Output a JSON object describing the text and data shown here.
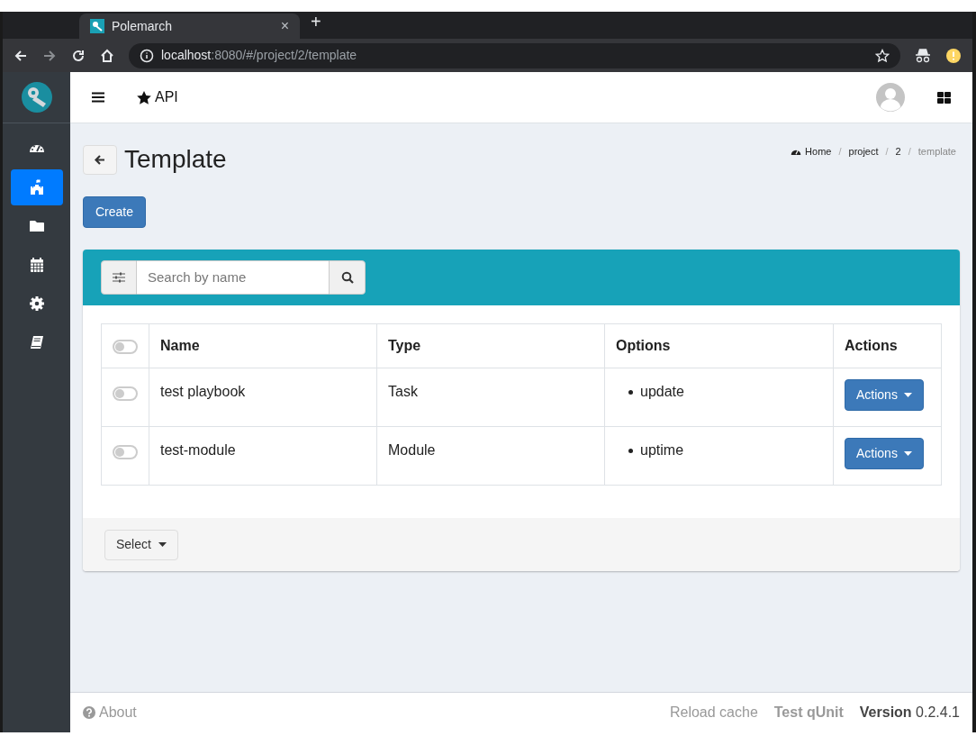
{
  "browser": {
    "tab_title": "Polemarch",
    "tab_close": "×",
    "new_tab": "+",
    "url_host": "localhost",
    "url_rest": ":8080/#/project/2/template"
  },
  "sidebar": {
    "items": [
      {
        "selected": false
      },
      {
        "selected": true
      },
      {
        "selected": false
      },
      {
        "selected": false
      },
      {
        "selected": false
      },
      {
        "selected": false
      }
    ]
  },
  "header": {
    "api_link": "API"
  },
  "page": {
    "title": "Template",
    "breadcrumbs": [
      {
        "label": "Home",
        "current": false
      },
      {
        "label": "project",
        "current": false
      },
      {
        "label": "2",
        "current": false
      },
      {
        "label": "template",
        "current": true
      }
    ],
    "separator": "/",
    "create_button": "Create"
  },
  "search": {
    "placeholder": "Search by name"
  },
  "table": {
    "select_all": {
      "selected": false
    },
    "columns": [
      "Name",
      "Type",
      "Options",
      "Actions"
    ],
    "rows": [
      {
        "selected": false,
        "name": "test playbook",
        "type": "Task",
        "options": [
          "update"
        ],
        "action": "Actions"
      },
      {
        "selected": false,
        "name": "test-module",
        "type": "Module",
        "options": [
          "uptime"
        ],
        "action": "Actions"
      }
    ]
  },
  "select_button": "Select",
  "footer": {
    "about": "About",
    "reload": "Reload cache",
    "test": "Test qUnit",
    "version": "**Version** 0.2.4.1"
  }
}
